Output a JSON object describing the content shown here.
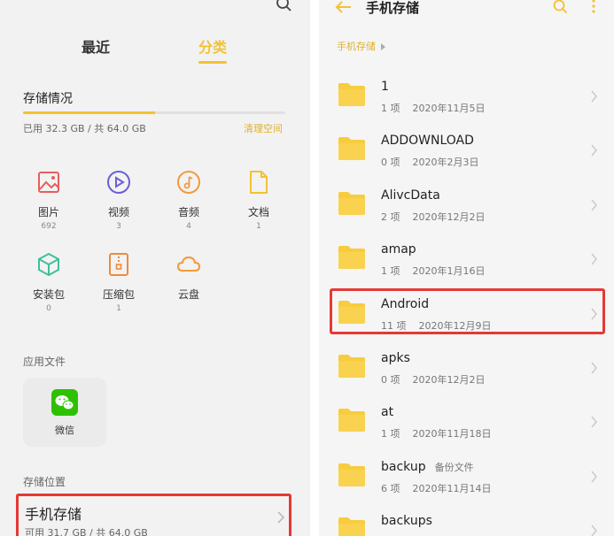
{
  "left": {
    "tabs": {
      "recent": "最近",
      "category": "分类"
    },
    "storage_section": "存储情况",
    "used_text": "已用 32.3 GB / 共 64.0 GB",
    "used_fraction": 0.505,
    "clean_label": "清理空间",
    "categories": [
      {
        "label": "图片",
        "count": "692",
        "icon": "image-icon",
        "color": "#e85d5d"
      },
      {
        "label": "视频",
        "count": "3",
        "icon": "video-icon",
        "color": "#6a5fd8"
      },
      {
        "label": "音频",
        "count": "4",
        "icon": "audio-icon",
        "color": "#f29a3d"
      },
      {
        "label": "文档",
        "count": "1",
        "icon": "document-icon",
        "color": "#f2c230"
      },
      {
        "label": "安装包",
        "count": "0",
        "icon": "package-icon",
        "color": "#3fc09a"
      },
      {
        "label": "压缩包",
        "count": "1",
        "icon": "zip-icon",
        "color": "#f08a3a"
      },
      {
        "label": "云盘",
        "count": "",
        "icon": "cloud-icon",
        "color": "#f29a3d"
      }
    ],
    "app_section": "应用文件",
    "apps": [
      {
        "label": "微信",
        "icon": "wechat-icon",
        "color": "#2dc100"
      }
    ],
    "location_section": "存储位置",
    "phone_storage": {
      "title": "手机存储",
      "subtitle": "可用 31.7 GB / 共 64.0 GB"
    }
  },
  "right": {
    "title": "手机存储",
    "breadcrumb": "手机存储",
    "folders": [
      {
        "name": "1",
        "note": "",
        "count": "1 项",
        "date": "2020年11月5日"
      },
      {
        "name": "ADDOWNLOAD",
        "note": "",
        "count": "0 项",
        "date": "2020年2月3日"
      },
      {
        "name": "AlivcData",
        "note": "",
        "count": "2 项",
        "date": "2020年12月2日"
      },
      {
        "name": "amap",
        "note": "",
        "count": "1 项",
        "date": "2020年1月16日"
      },
      {
        "name": "Android",
        "note": "",
        "count": "11 项",
        "date": "2020年12月9日"
      },
      {
        "name": "apks",
        "note": "",
        "count": "0 项",
        "date": "2020年12月2日"
      },
      {
        "name": "at",
        "note": "",
        "count": "1 项",
        "date": "2020年11月18日"
      },
      {
        "name": "backup",
        "note": "备份文件",
        "count": "6 项",
        "date": "2020年11月14日"
      },
      {
        "name": "backups",
        "note": "",
        "count": "",
        "date": ""
      }
    ]
  },
  "colors": {
    "accent": "#f2c230",
    "folder": "#f7cc3e",
    "highlight": "#e53935"
  }
}
